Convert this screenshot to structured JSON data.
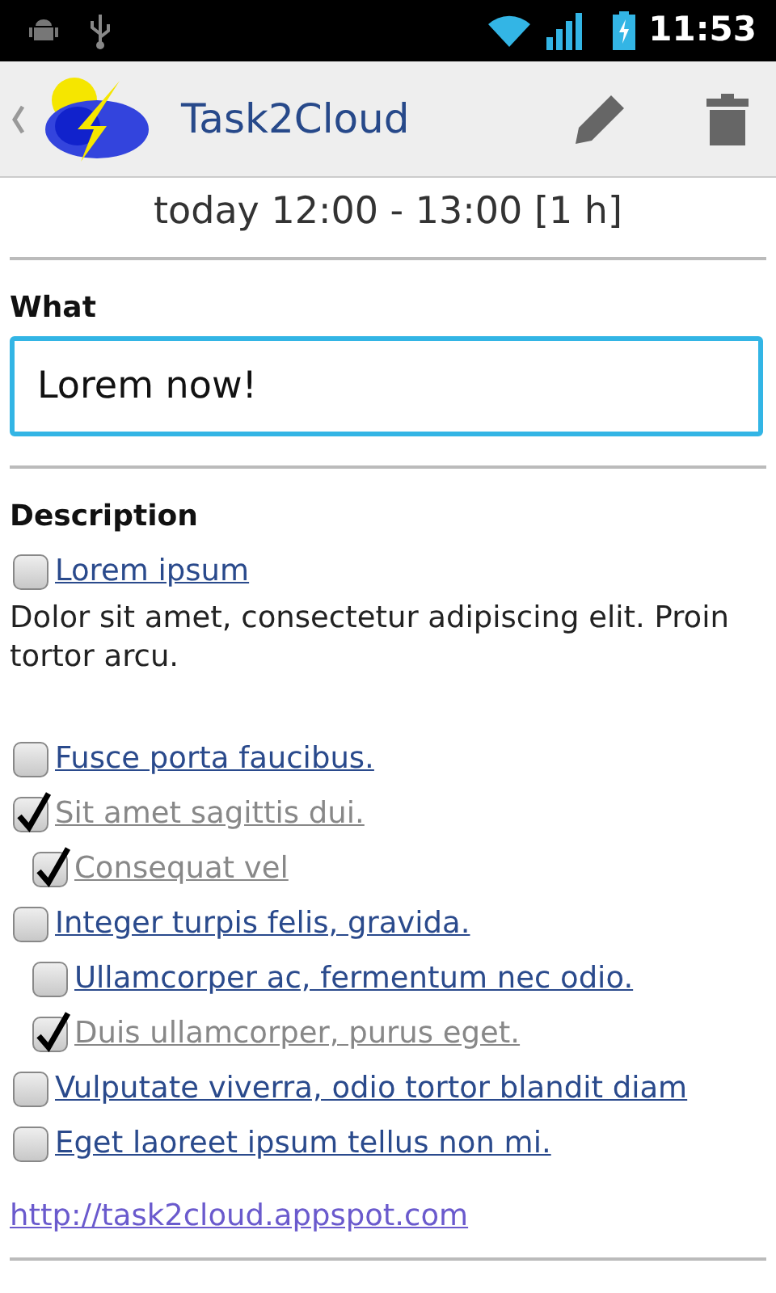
{
  "status_bar": {
    "time": "11:53"
  },
  "action_bar": {
    "title": "Task2Cloud"
  },
  "when": "today 12:00 - 13:00 [1 h]",
  "what": {
    "label": "What",
    "value": "Lorem now!"
  },
  "description": {
    "label": "Description",
    "items": [
      {
        "label": "Lorem ipsum",
        "checked": false,
        "note": "Dolor sit amet, consectetur adipiscing elit. Proin tortor arcu."
      },
      {
        "label": "Fusce porta faucibus.",
        "checked": false
      },
      {
        "label": "Sit amet sagittis dui.",
        "checked": true,
        "children": [
          {
            "label": "Consequat vel",
            "checked": true
          }
        ]
      },
      {
        "label": "Integer turpis felis, gravida.",
        "checked": false,
        "children": [
          {
            "label": "Ullamcorper ac, fermentum nec odio.",
            "checked": false
          },
          {
            "label": "Duis ullamcorper, purus eget.",
            "checked": true
          }
        ]
      },
      {
        "label": "Vulputate viverra, odio tortor blandit diam",
        "checked": false
      },
      {
        "label": "Eget laoreet ipsum tellus non mi.",
        "checked": false
      }
    ],
    "link": "http://task2cloud.appspot.com"
  }
}
